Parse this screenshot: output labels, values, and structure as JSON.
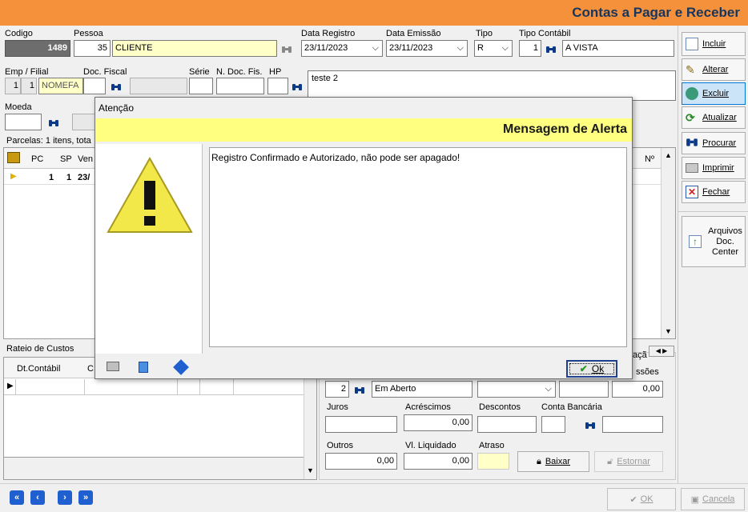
{
  "header": {
    "title": "Contas a Pagar e Receber"
  },
  "form": {
    "codigo_label": "Codigo",
    "codigo_value": "1489",
    "pessoa_label": "Pessoa",
    "pessoa_id": "35",
    "pessoa_name": "CLIENTE",
    "data_registro_label": "Data Registro",
    "data_registro_value": "23/11/2023",
    "data_emissao_label": "Data Emissão",
    "data_emissao_value": "23/11/2023",
    "tipo_label": "Tipo",
    "tipo_value": "R",
    "tipo_contabil_label": "Tipo Contábil",
    "tipo_contabil_id": "1",
    "tipo_contabil_name": "A VISTA",
    "emp_filial_label": "Emp / Filial",
    "emp_value": "1",
    "filial_value": "1",
    "emp_name": "NOMEFA",
    "doc_fiscal_label": "Doc. Fiscal",
    "serie_label": "Série",
    "ndoc_fis_label": "N. Doc. Fis.",
    "hp_label": "HP",
    "obs_value": "teste 2",
    "moeda_label": "Moeda",
    "parcelas_summary": "Parcelas: 1 itens, tota"
  },
  "parcelas_grid": {
    "columns": [
      "PC",
      "SP",
      "Ven"
    ],
    "last_col": "Nº",
    "row": {
      "pc": "1",
      "sp": "1",
      "ven": "23/"
    }
  },
  "rateio": {
    "title": "Rateio de Custos",
    "columns": [
      "Dt.Contábil",
      "C"
    ]
  },
  "detalhes": {
    "tab_fragment": "açã",
    "status_id": "2",
    "status_name": "Em Aberto",
    "comissoes_label": "ssões",
    "comissoes_value": "0,00",
    "juros_label": "Juros",
    "acrescimos_label": "Acréscimos",
    "acrescimos_value": "0,00",
    "descontos_label": "Descontos",
    "conta_bancaria_label": "Conta Bancária",
    "outros_label": "Outros",
    "outros_value": "0,00",
    "vl_liquidado_label": "Vl. Liquidado",
    "vl_liquidado_value": "0,00",
    "atraso_label": "Atraso",
    "baixar_label": "Baixar",
    "estornar_label": "Estornar"
  },
  "toolbar": {
    "incluir": "Incluir",
    "alterar": "Alterar",
    "excluir": "Excluir",
    "atualizar": "Atualizar",
    "procurar": "Procurar",
    "imprimir": "Imprimir",
    "fechar": "Fechar",
    "arquivos_1": "Arquivos",
    "arquivos_2": "Doc.",
    "arquivos_3": "Center"
  },
  "bottom": {
    "ok_label": "OK",
    "cancela_label": "Cancela"
  },
  "dialog": {
    "title": "Atenção",
    "heading": "Mensagem de Alerta",
    "message": "Registro Confirmado e Autorizado, não pode ser apagado!",
    "ok_label": "Ok"
  },
  "colors": {
    "header_orange": "#f5903b",
    "title_navy": "#17365d",
    "alert_yellow": "#ffff80",
    "field_yellow": "#ffffc8"
  }
}
